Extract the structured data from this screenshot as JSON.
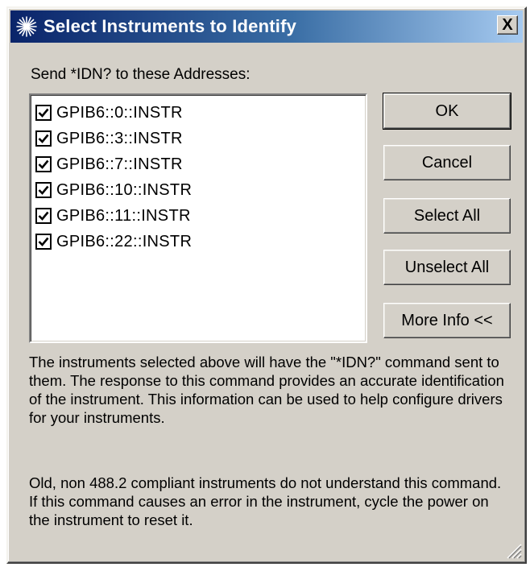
{
  "window": {
    "title": "Select Instruments to Identify",
    "close_glyph": "X"
  },
  "prompt": "Send *IDN? to these Addresses:",
  "addresses": [
    {
      "label": "GPIB6::0::INSTR",
      "checked": true
    },
    {
      "label": "GPIB6::3::INSTR",
      "checked": true
    },
    {
      "label": "GPIB6::7::INSTR",
      "checked": true
    },
    {
      "label": "GPIB6::10::INSTR",
      "checked": true
    },
    {
      "label": "GPIB6::11::INSTR",
      "checked": true
    },
    {
      "label": "GPIB6::22::INSTR",
      "checked": true
    }
  ],
  "buttons": {
    "ok": "OK",
    "cancel": "Cancel",
    "select_all": "Select All",
    "unselect_all": "Unselect All",
    "more_info": "More Info <<"
  },
  "info": {
    "paragraph1": "The instruments selected above will have the \"*IDN?\" command sent to them.  The response to this command provides an accurate identification of the instrument.  This information can be used to help configure drivers for your instruments.",
    "paragraph2": "Old, non 488.2 compliant instruments do not understand this command.  If this command causes an error in the instrument, cycle the power on the instrument to reset it."
  },
  "icons": {
    "app": "agilent-spark-icon",
    "check": "checkmark-icon",
    "grip": "resize-grip-icon"
  },
  "colors": {
    "title_gradient_start": "#0a246a",
    "title_gradient_end": "#a6caf0",
    "dialog_face": "#d4d0c8"
  }
}
